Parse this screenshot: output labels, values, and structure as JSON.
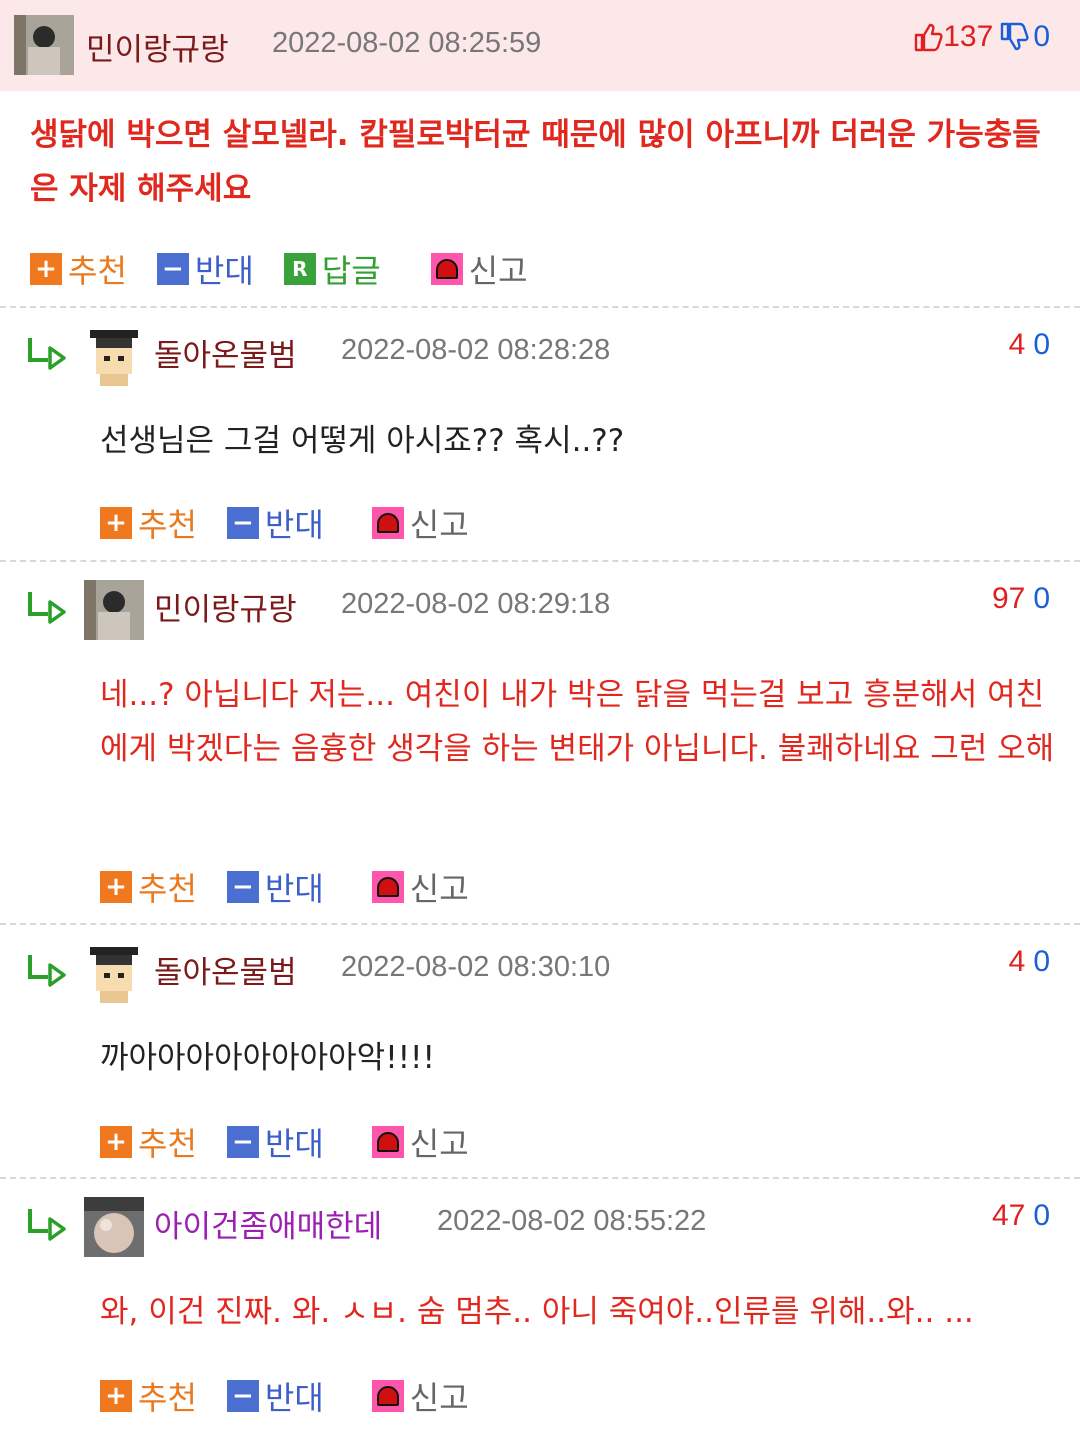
{
  "top_comment": {
    "nickname": "민이랑규랑",
    "timestamp": "2022-08-02 08:25:59",
    "upvotes": "137",
    "downvotes": "0",
    "body": "생닭에 박으면 살모넬라. 캄필로박터균 때문에 많이 아프니까 더러운 가능충들은 자제 해주세요",
    "actions": {
      "recommend": "추천",
      "oppose": "반대",
      "reply": "답글",
      "report": "신고"
    },
    "reply_badge": "R"
  },
  "replies": [
    {
      "nickname": "돌아온물범",
      "timestamp": "2022-08-02 08:28:28",
      "up": "4",
      "down": "0",
      "body": "선생님은 그걸 어떻게 아시죠?? 혹시..??",
      "actions": {
        "recommend": "추천",
        "oppose": "반대",
        "report": "신고"
      }
    },
    {
      "nickname": "민이랑규랑",
      "timestamp": "2022-08-02 08:29:18",
      "up": "97",
      "down": "0",
      "body": "네...? 아닙니다 저는... 여친이 내가 박은 닭을 먹는걸 보고 흥분해서 여친에게 박겠다는 음흉한 생각을 하는 변태가 아닙니다. 불쾌하네요 그런 오해",
      "actions": {
        "recommend": "추천",
        "oppose": "반대",
        "report": "신고"
      }
    },
    {
      "nickname": "돌아온물범",
      "timestamp": "2022-08-02 08:30:10",
      "up": "4",
      "down": "0",
      "body": "까아아아아아아아아악!!!!",
      "actions": {
        "recommend": "추천",
        "oppose": "반대",
        "report": "신고"
      }
    },
    {
      "nickname": "아이건좀애매한데",
      "timestamp": "2022-08-02 08:55:22",
      "up": "47",
      "down": "0",
      "body": "와, 이건 진짜. 와. ㅅㅂ. 숨 멈추.. 아니 죽여야..인류를 위해..와.. ...",
      "actions": {
        "recommend": "추천",
        "oppose": "반대",
        "report": "신고"
      }
    }
  ],
  "colors": {
    "header_bg": "#fde8e9",
    "red_text": "#e0281e",
    "nick_red": "#7a1a1a",
    "nick_purple": "#9b1fb0",
    "up": "#e02020",
    "down": "#1a5fd8"
  },
  "icons": {
    "thumb_up": "thumbs-up-icon",
    "thumb_down": "thumbs-down-icon",
    "reply_arrow": "reply-arrow-icon",
    "report": "siren-icon"
  }
}
